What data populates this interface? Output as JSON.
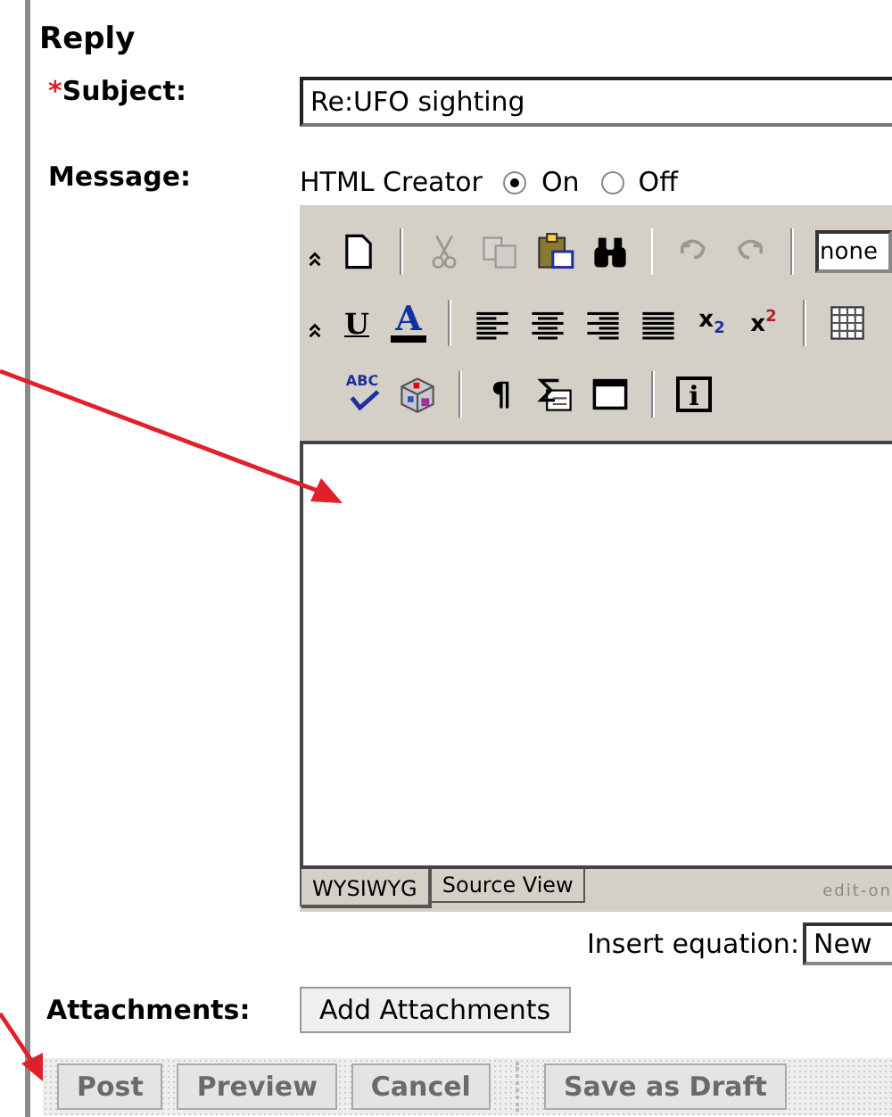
{
  "section_title": "Reply",
  "subject": {
    "required_mark": "*",
    "label": "Subject:",
    "value": "Re:UFO sighting"
  },
  "message": {
    "label": "Message:",
    "html_creator": {
      "label": "HTML Creator",
      "options": [
        {
          "label": "On",
          "selected": true
        },
        {
          "label": "Off",
          "selected": false
        }
      ]
    },
    "toolbar": [
      [
        {
          "kind": "collapse"
        },
        {
          "kind": "new"
        },
        {
          "kind": "sep"
        },
        {
          "kind": "cut",
          "disabled": true
        },
        {
          "kind": "copy",
          "disabled": true
        },
        {
          "kind": "paste",
          "disabled": false
        },
        {
          "kind": "find",
          "disabled": false
        },
        {
          "kind": "sep"
        },
        {
          "kind": "undo",
          "disabled": true
        },
        {
          "kind": "redo",
          "disabled": true
        },
        {
          "kind": "sep"
        },
        {
          "kind": "select",
          "value": "none"
        }
      ],
      [
        {
          "kind": "collapse"
        },
        {
          "kind": "underline",
          "glyph": "U"
        },
        {
          "kind": "fontcolor",
          "glyph": "A"
        },
        {
          "kind": "sep"
        },
        {
          "kind": "align-left"
        },
        {
          "kind": "align-center"
        },
        {
          "kind": "align-right"
        },
        {
          "kind": "justify"
        },
        {
          "kind": "subscript",
          "glyph": "x",
          "index": "2"
        },
        {
          "kind": "superscript",
          "glyph": "x",
          "index": "2"
        },
        {
          "kind": "sep"
        },
        {
          "kind": "table"
        }
      ],
      [
        {
          "kind": "spellcheck",
          "glyph": "ABC"
        },
        {
          "kind": "cube"
        },
        {
          "kind": "sep"
        },
        {
          "kind": "pilcrow",
          "glyph": "¶"
        },
        {
          "kind": "sigma"
        },
        {
          "kind": "window"
        },
        {
          "kind": "sep"
        },
        {
          "kind": "info",
          "glyph": "i"
        }
      ]
    ],
    "tabs": [
      {
        "label": "WYSIWYG",
        "selected": true
      },
      {
        "label": "Source View",
        "selected": false
      }
    ],
    "footer_text": "edit-on"
  },
  "equation": {
    "label": "Insert equation:",
    "value": "New"
  },
  "attachments": {
    "label": "Attachments:",
    "button": "Add Attachments"
  },
  "actions": [
    "Post",
    "Preview",
    "Cancel"
  ],
  "secondary_actions": [
    "Save as Draft"
  ]
}
